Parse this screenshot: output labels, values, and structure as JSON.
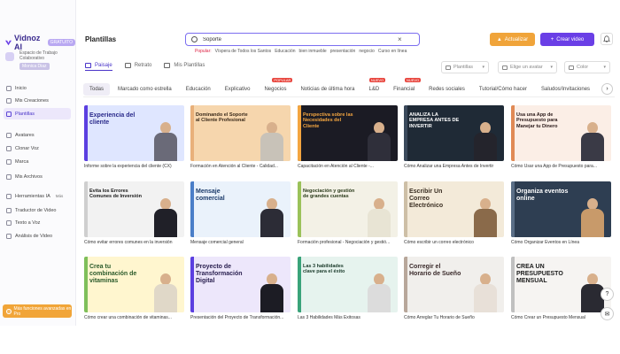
{
  "app": {
    "name": "Vidnoz AI",
    "badge": "GRATUITO"
  },
  "workspace": {
    "title": "Espacio de Trabajo Colaborativo",
    "user": "Monica Diaz"
  },
  "nav": [
    {
      "label": "Inicio",
      "icon": "home-icon"
    },
    {
      "label": "Mis Creaciones",
      "icon": "folder-icon"
    },
    {
      "label": "Plantillas",
      "icon": "template-icon"
    },
    {
      "label": "Avatares",
      "icon": "avatar-icon"
    },
    {
      "label": "Clonar Voz",
      "icon": "voice-icon"
    },
    {
      "label": "Marca",
      "icon": "brand-icon"
    },
    {
      "label": "Mis Archivos",
      "icon": "file-icon"
    },
    {
      "label": "Herramientas IA",
      "icon": "tools-icon",
      "badge": "Más"
    },
    {
      "label": "Traductor de Video",
      "icon": "translate-icon"
    },
    {
      "label": "Texto a Voz",
      "icon": "tts-icon"
    },
    {
      "label": "Análisis de Video",
      "icon": "analysis-icon"
    }
  ],
  "upgrade_banner": "Más funciones avanzadas en Pro",
  "header": {
    "title": "Plantillas",
    "search_value": "Soporte",
    "popular_label": "Popular:",
    "popular": [
      "Víspera de Todos los Santos",
      "Educación",
      "bien inmueble",
      "presentación",
      "negocio",
      "Curso en línea"
    ],
    "upgrade_label": "Actualizar",
    "create_label": "Crear video"
  },
  "tabs": [
    {
      "label": "Paisaje",
      "active": true
    },
    {
      "label": "Retrato",
      "active": false
    },
    {
      "label": "Mis Plantillas",
      "active": false
    }
  ],
  "filters": [
    "Plantillas",
    "Elige un avatar",
    "Color"
  ],
  "categories": [
    {
      "label": "Todas",
      "active": true
    },
    {
      "label": "Marcado como estrella"
    },
    {
      "label": "Educación"
    },
    {
      "label": "Explicativo"
    },
    {
      "label": "Negocios",
      "tag": "POPULAR"
    },
    {
      "label": "Noticias de última hora"
    },
    {
      "label": "L&D",
      "tag": "NUEVO"
    },
    {
      "label": "Financial",
      "tag": "NUEVO"
    },
    {
      "label": "Redes sociales"
    },
    {
      "label": "Tutorial/Cómo hacer"
    },
    {
      "label": "Saludos/Invitaciones"
    },
    {
      "label": "P"
    }
  ],
  "cards": [
    {
      "caption": "Informe sobre la experiencia del cliente (CX)",
      "title": "Experiencia del cliente",
      "bg": "#dfe6ff",
      "fg": "#2a2a8a",
      "accent": "#5b3fe0",
      "suit": "#6a6a78"
    },
    {
      "caption": "Formación en Atención al Cliente - Calidad...",
      "title": "Dominando el Soporte al Cliente Profesional",
      "bg": "#f6d6ad",
      "fg": "#3a2a1a",
      "accent": "#e8b07a",
      "suit": "#c8c2b8"
    },
    {
      "caption": "Capacitación en Atención al Cliente -...",
      "title": "Perspectiva sobre las Necesidades del Cliente",
      "bg": "#1b1b24",
      "fg": "#f4a640",
      "accent": "#f4a640",
      "suit": "#2f2f3a"
    },
    {
      "caption": "Cómo Analizar una Empresa Antes de Invertir",
      "title": "ANALIZA LA EMPRESA ANTES DE INVERTIR",
      "bg": "#1f2a36",
      "fg": "#ffffff",
      "accent": "#3b4a5c",
      "suit": "#24242c"
    },
    {
      "caption": "Cómo Usar una App de Presupuesto para...",
      "title": "Usa una App de Presupuesto para Manejar tu Dinero",
      "bg": "#fbeee6",
      "fg": "#2a1a1a",
      "accent": "#e08a55",
      "suit": "#3a3a46"
    },
    {
      "caption": "Cómo evitar errores comunes en la inversión",
      "title": "Evita los Errores Comunes de Inversión",
      "bg": "#f2f2f2",
      "fg": "#1a1a1a",
      "accent": "#cfcfcf",
      "suit": "#202028"
    },
    {
      "caption": "Mensaje comercial general",
      "title": "Mensaje comercial",
      "bg": "#eaf2fb",
      "fg": "#1a3a6a",
      "accent": "#4a7ec8",
      "suit": "#2c2c36"
    },
    {
      "caption": "Formación profesional - Negociación y gestió...",
      "title": "Negociación y gestión de grandes cuentas",
      "bg": "#f3f1e6",
      "fg": "#2a3a1a",
      "accent": "#9bc25a",
      "suit": "#e8e4d4"
    },
    {
      "caption": "Cómo escribir un correo electrónico",
      "title": "Escribir Un Correo Electrónico",
      "bg": "#f3ead9",
      "fg": "#3a2e22",
      "accent": "#cdbfa6",
      "suit": "#8a6a4a"
    },
    {
      "caption": "Cómo Organizar Eventos en Línea",
      "title": "Organiza eventos online",
      "bg": "#2e3e52",
      "fg": "#ffffff",
      "accent": "#5a6e86",
      "suit": "#c89a6a"
    },
    {
      "caption": "Cómo crear una combinación de vitaminas...",
      "title": "Crea tu combinación de vitaminas",
      "bg": "#fff6cf",
      "fg": "#2a5a2a",
      "accent": "#7fbf5a",
      "suit": "#e0d8c8"
    },
    {
      "caption": "Presentación del Proyecto de Transformación...",
      "title": "Proyecto de Transformación Digital",
      "bg": "#ede7fb",
      "fg": "#2a2050",
      "accent": "#5b3fe0",
      "suit": "#1c1c24"
    },
    {
      "caption": "Las 3 Habilidades Más Exitosas",
      "title": "Las 3 habilidades clave para el éxito",
      "bg": "#e6f3ee",
      "fg": "#1a3a2a",
      "accent": "#3aa37a",
      "suit": "#dcdcdc"
    },
    {
      "caption": "Cómo Arreglar Tu Horario de Sueño",
      "title": "Corregir el Horario de Sueño",
      "bg": "#f1efec",
      "fg": "#3a2a2a",
      "accent": "#b8a79a",
      "suit": "#e8e0d8"
    },
    {
      "caption": "Cómo Crear un Presupuesto Mensual",
      "title": "CREA UN PRESUPUESTO MENSUAL",
      "bg": "#f6f4f2",
      "fg": "#1a1a1a",
      "accent": "#c0c0c0",
      "suit": "#2a2a32"
    }
  ]
}
